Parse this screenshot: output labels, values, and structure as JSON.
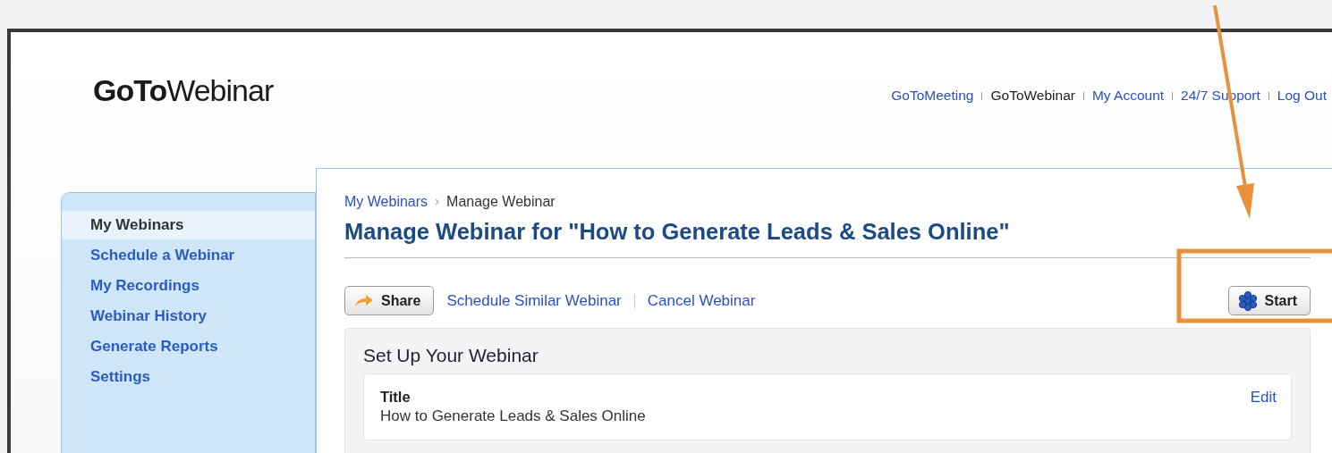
{
  "logo": "**GoTo**Webinar",
  "top_nav": [
    {
      "label": "GoToMeeting",
      "selected": false
    },
    {
      "label": "GoToWebinar",
      "selected": true
    },
    {
      "label": "My Account",
      "selected": false
    },
    {
      "label": "24/7 Support",
      "selected": false
    },
    {
      "label": "Log Out",
      "selected": false
    }
  ],
  "sidebar": {
    "items": [
      {
        "label": "My Webinars",
        "selected": true
      },
      {
        "label": "Schedule a Webinar",
        "selected": false
      },
      {
        "label": "My Recordings",
        "selected": false
      },
      {
        "label": "Webinar History",
        "selected": false
      },
      {
        "label": "Generate Reports",
        "selected": false
      },
      {
        "label": "Settings",
        "selected": false
      }
    ]
  },
  "breadcrumb": [
    "My Webinars",
    "Manage Webinar"
  ],
  "page_title": "Manage Webinar for \"How to Generate Leads & Sales Online\"",
  "actions": {
    "share_button": "Share",
    "links": [
      "Schedule Similar Webinar",
      "Cancel Webinar"
    ],
    "start_button": "Start"
  },
  "setup": {
    "heading": "Set Up Your Webinar",
    "fields": [
      {
        "label": "Title",
        "value": "How to Generate Leads & Sales Online",
        "action": "Edit"
      }
    ]
  },
  "annotations": {
    "arrow": true,
    "highlight_box": true
  }
}
